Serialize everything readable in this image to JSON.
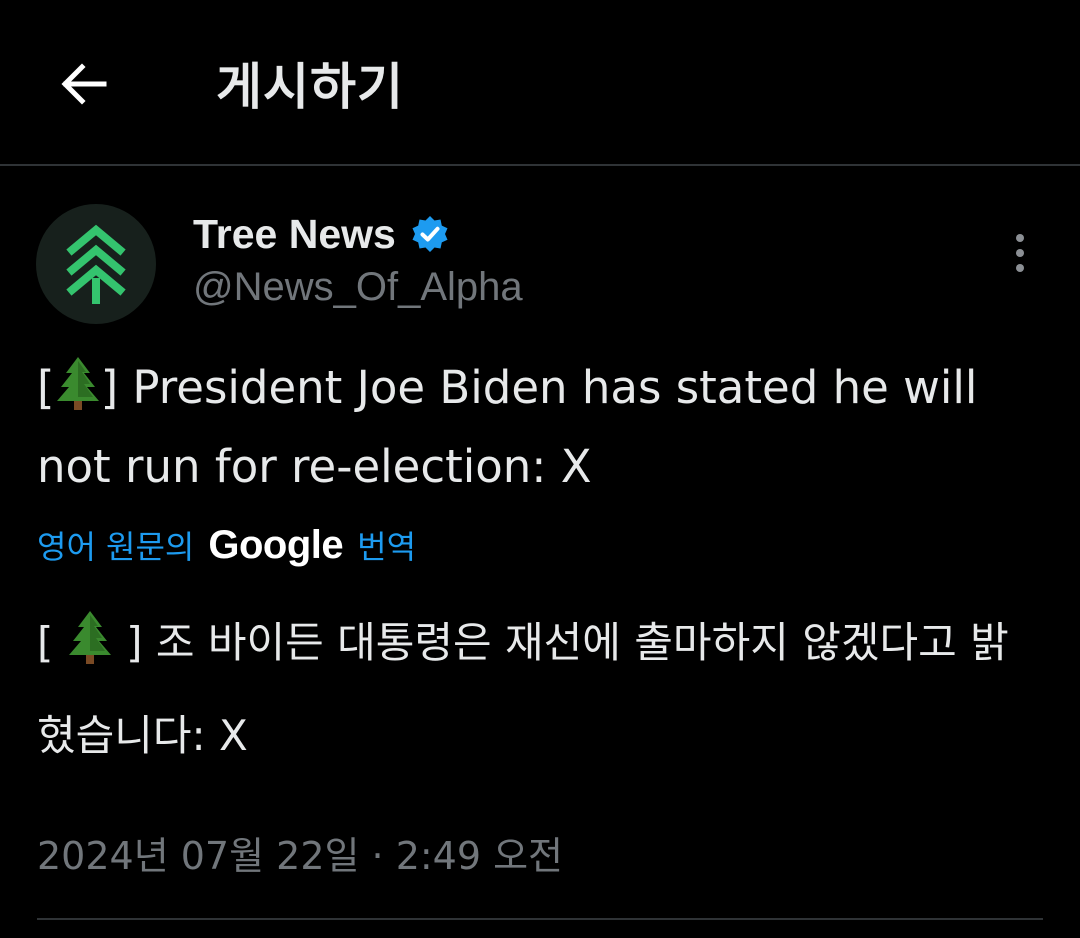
{
  "header": {
    "title": "게시하기",
    "back_icon": "arrow-left-icon"
  },
  "author": {
    "name": "Tree News",
    "handle": "@News_Of_Alpha",
    "verified_icon": "verified-badge-icon",
    "verified_color": "#1d9bf0",
    "avatar_icon": "tree-logo-icon",
    "avatar_accent": "#34c46e"
  },
  "post": {
    "text_open": "[",
    "text_emoji": "🌲",
    "text_body": "] President Joe Biden has stated he will not run for re-election: X",
    "translate_prefix": "영어 원문의",
    "translate_brand": "Google",
    "translate_suffix": "번역",
    "translated_open": "[",
    "translated_emoji": "🌲",
    "translated_body": "] 조 바이든 대통령은 재선에 출마하지 않겠다고 밝혔습니다: X",
    "timestamp": "2024년 07월 22일 · 2:49 오전"
  },
  "colors": {
    "background": "#000000",
    "text": "#e7e9ea",
    "secondary": "#71767b",
    "link": "#1d9bf0",
    "divider": "#2f3336"
  }
}
